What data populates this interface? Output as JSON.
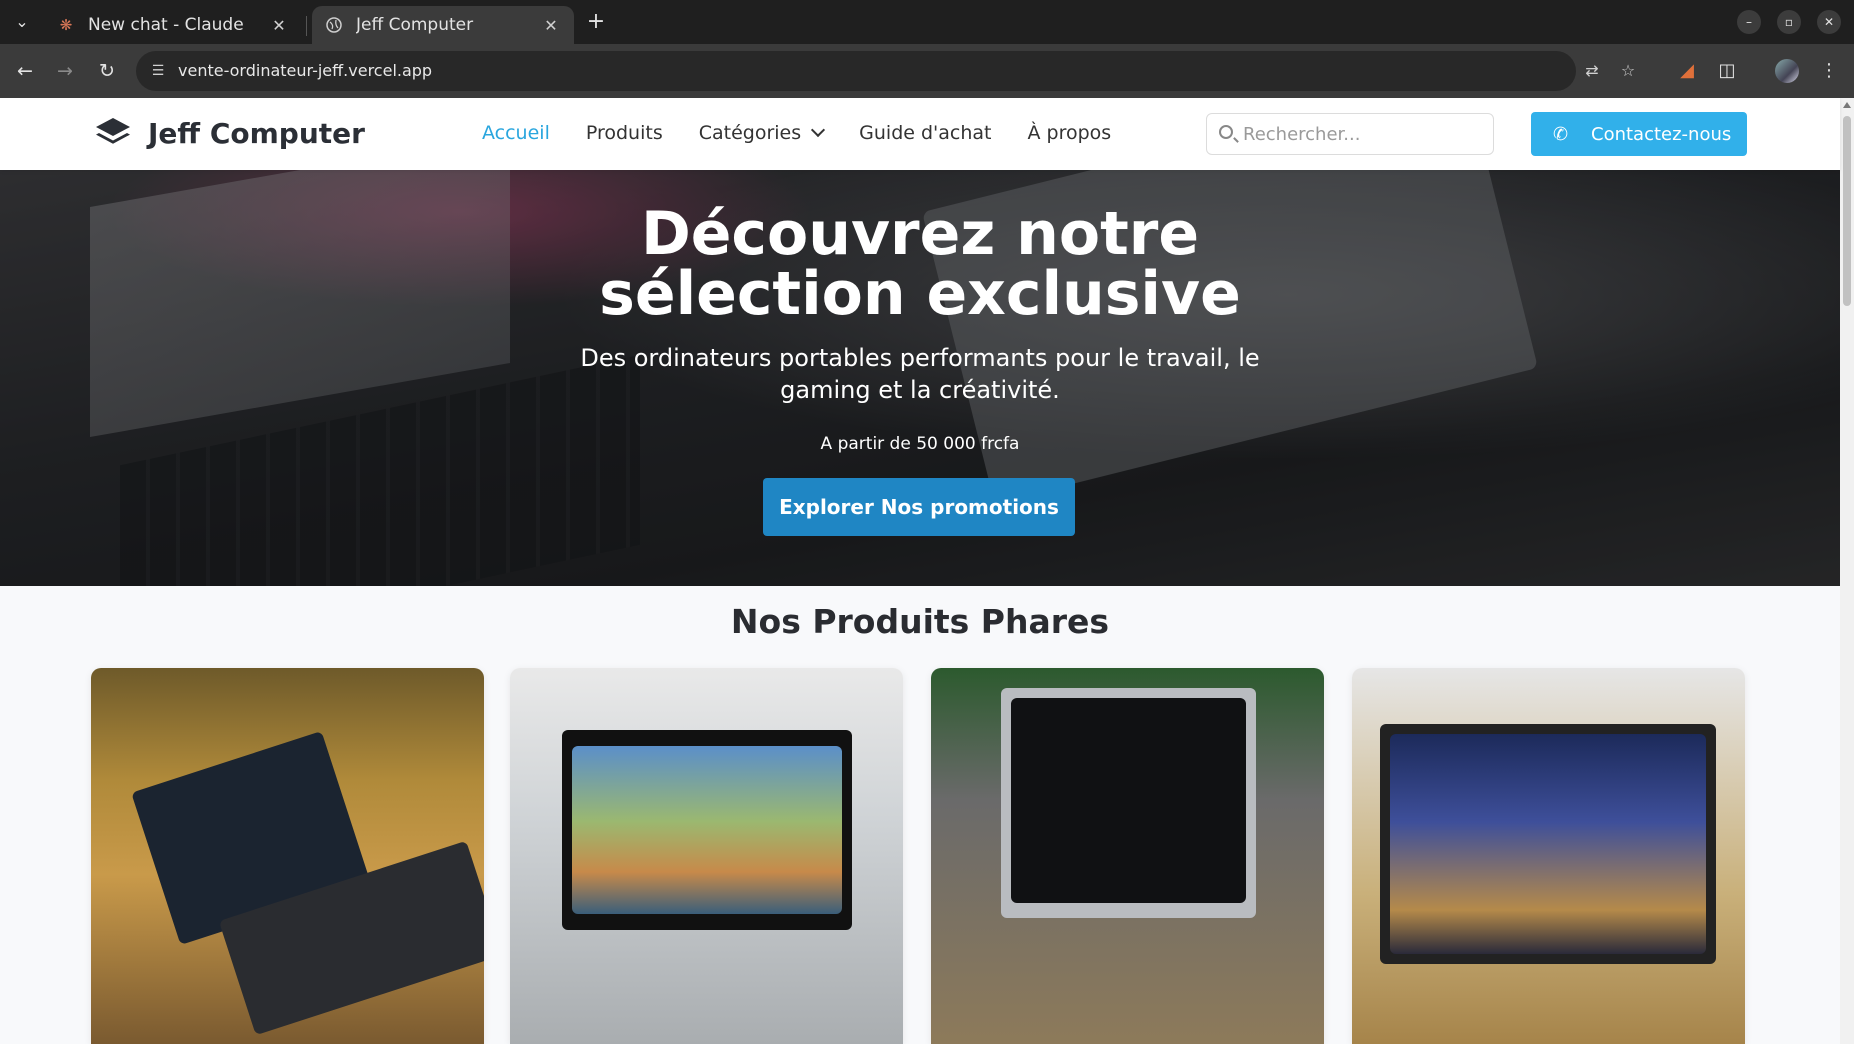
{
  "browser": {
    "tabs": [
      {
        "title": "New chat - Claude",
        "active": false
      },
      {
        "title": "Jeff Computer",
        "active": true
      }
    ],
    "url": "vente-ordinateur-jeff.vercel.app"
  },
  "site": {
    "brand": "Jeff Computer",
    "nav": [
      {
        "label": "Accueil",
        "active": true
      },
      {
        "label": "Produits",
        "active": false
      },
      {
        "label": "Catégories",
        "active": false
      },
      {
        "label": "Guide d'achat",
        "active": false
      },
      {
        "label": "À propos",
        "active": false
      }
    ],
    "search_placeholder": "Rechercher...",
    "contact_label": "Contactez-nous",
    "accent_color": "#2aa6de",
    "button_color": "#31b0ea"
  },
  "hero": {
    "title_line1": "Découvrez notre",
    "title_line2": "sélection exclusive",
    "subtitle": "Des ordinateurs portables performants pour le travail, le gaming et la créativité.",
    "price_note": "A partir de 50 000 frcfa",
    "cta_label": "Explorer Nos promotions",
    "cta_color": "#1f86c4"
  },
  "products_section": {
    "title": "Nos Produits Phares"
  }
}
